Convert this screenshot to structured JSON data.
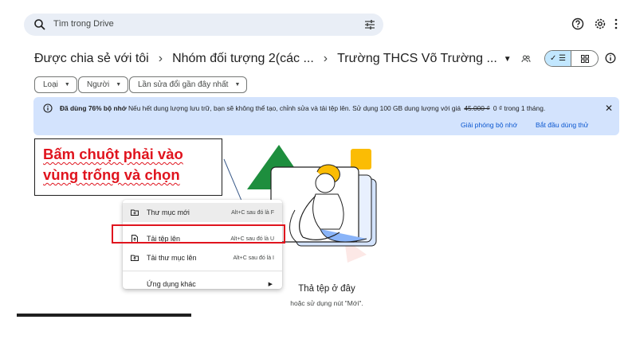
{
  "search": {
    "placeholder": "Tìm trong Drive"
  },
  "breadcrumb": {
    "items": [
      "Được chia sẻ với tôi",
      "Nhóm đối tượng 2(các ...",
      "Trường THCS Võ Trường ..."
    ],
    "separator": "›"
  },
  "filters": [
    "Loại",
    "Người",
    "Lần sửa đổi gần đây nhất"
  ],
  "banner": {
    "bold": "Đã dùng 76% bộ nhớ",
    "text": "Nếu hết dung lượng lưu trữ, bạn sẽ không thể tạo, chỉnh sửa và tải tệp lên. Sử dụng 100 GB dung lượng với giá",
    "old_price": "45.000 ₫",
    "new_price": "0 ₫ trong 1 tháng.",
    "link_free": "Giải phóng bộ nhớ",
    "link_trial": "Bắt đầu dùng thử"
  },
  "annotation": {
    "line1": "Bấm chuột phải vào",
    "line2": "vùng trống và chọn"
  },
  "menu": {
    "items": [
      {
        "label": "Thư mục mới",
        "shortcut": "Alt+C sau đó là F"
      },
      {
        "label": "Tải tệp lên",
        "shortcut": "Alt+C sau đó là U"
      },
      {
        "label": "Tải thư mục lên",
        "shortcut": "Alt+C sau đó là I"
      },
      {
        "label": "Ứng dụng khác",
        "shortcut": ""
      }
    ]
  },
  "empty": {
    "title": "Thả tệp ở đây",
    "subtitle": "hoặc sử dụng nút \"Mới\"."
  },
  "colors": {
    "annotation": "#e0141e",
    "banner_bg": "#d3e3fd",
    "link": "#0b57d0",
    "search_bg": "#e9eef6"
  }
}
